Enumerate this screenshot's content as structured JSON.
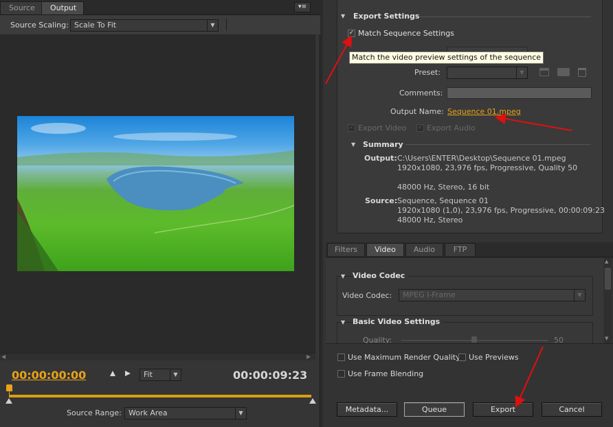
{
  "source_tabs": {
    "source": "Source",
    "output": "Output"
  },
  "source_scaling": {
    "label": "Source Scaling:",
    "value": "Scale To Fit"
  },
  "timecode": {
    "current": "00:00:00:00",
    "duration": "00:00:09:23",
    "zoom": "Fit"
  },
  "source_range": {
    "label": "Source Range:",
    "value": "Work Area"
  },
  "export_settings": {
    "title": "Export Settings",
    "match_sequence": "Match Sequence Settings",
    "tooltip": "Match the video preview settings of the sequence",
    "preset_label": "Preset:",
    "comments_label": "Comments:",
    "output_name_label": "Output Name:",
    "output_name": "Sequence 01.mpeg",
    "export_video": "Export Video",
    "export_audio": "Export Audio"
  },
  "summary": {
    "title": "Summary",
    "output_label": "Output:",
    "output_lines": [
      "C:\\Users\\ENTER\\Desktop\\Sequence 01.mpeg",
      "1920x1080, 23,976 fps, Progressive, Quality 50",
      "",
      "48000 Hz, Stereo, 16 bit"
    ],
    "source_label": "Source:",
    "source_lines": [
      "Sequence, Sequence 01",
      "1920x1080 (1,0), 23,976 fps, Progressive, 00:00:09:23",
      "48000 Hz, Stereo"
    ]
  },
  "settings_tabs": {
    "filters": "Filters",
    "video": "Video",
    "audio": "Audio",
    "ftp": "FTP"
  },
  "video_codec": {
    "title": "Video Codec",
    "label": "Video Codec:",
    "value": "MPEG I-Frame"
  },
  "basic_video": {
    "title": "Basic Video Settings",
    "quality_label": "Quality:",
    "quality_value": "50",
    "quality_fraction": 0.5
  },
  "options": {
    "max_render": "Use Maximum Render Quality",
    "use_previews": "Use Previews",
    "frame_blending": "Use Frame Blending"
  },
  "buttons": {
    "metadata": "Metadata...",
    "queue": "Queue",
    "export": "Export",
    "cancel": "Cancel"
  },
  "colors": {
    "accent": "#e8a317",
    "arrow": "#e01010"
  }
}
